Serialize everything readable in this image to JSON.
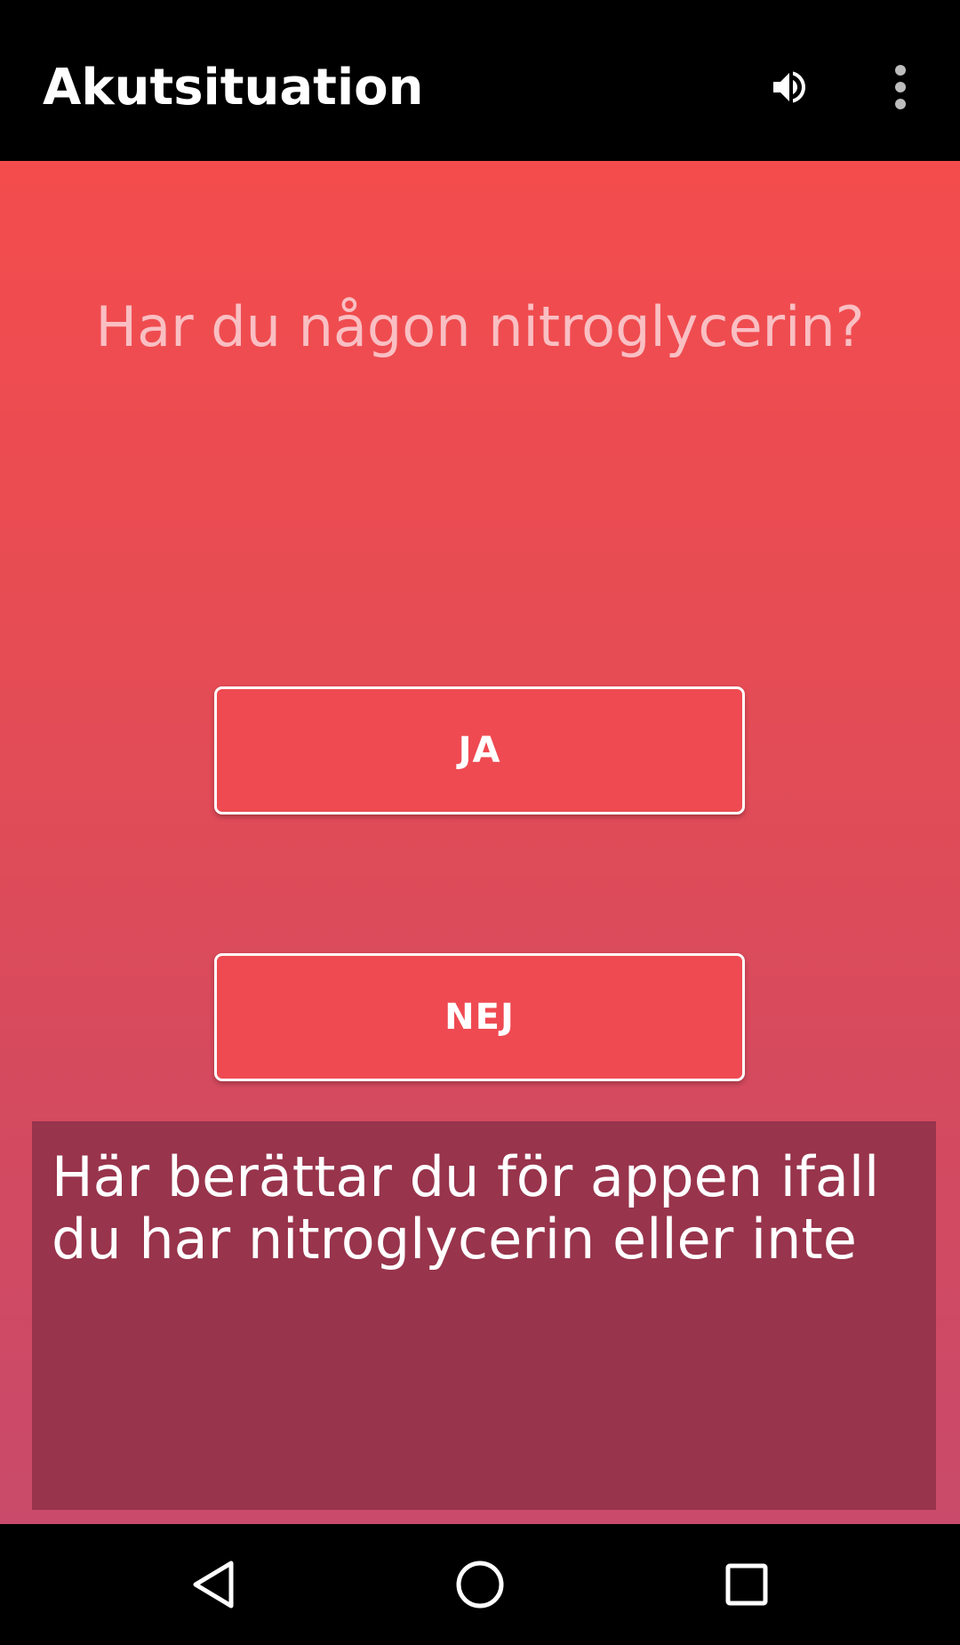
{
  "app_bar": {
    "title": "Akutsituation",
    "volume_icon": "volume-up-icon",
    "menu_icon": "more-vert-icon"
  },
  "question": {
    "text": "Har du någon nitroglycerin?"
  },
  "buttons": {
    "yes_label": "JA",
    "no_label": "NEJ"
  },
  "help": {
    "text": "Här berättar du för appen ifall du har nitroglycerin eller inte"
  },
  "nav_bar": {
    "back_icon": "back-triangle-icon",
    "home_icon": "home-circle-icon",
    "recents_icon": "recents-square-icon"
  },
  "colors": {
    "app_bar_bg": "#000000",
    "gradient_top": "#f44c4d",
    "gradient_bottom": "#c94a6a",
    "question_text": "#f9bfc3",
    "button_fill": "#ef4a52",
    "button_border": "#ffffff",
    "help_box_bg": "#98344c"
  }
}
